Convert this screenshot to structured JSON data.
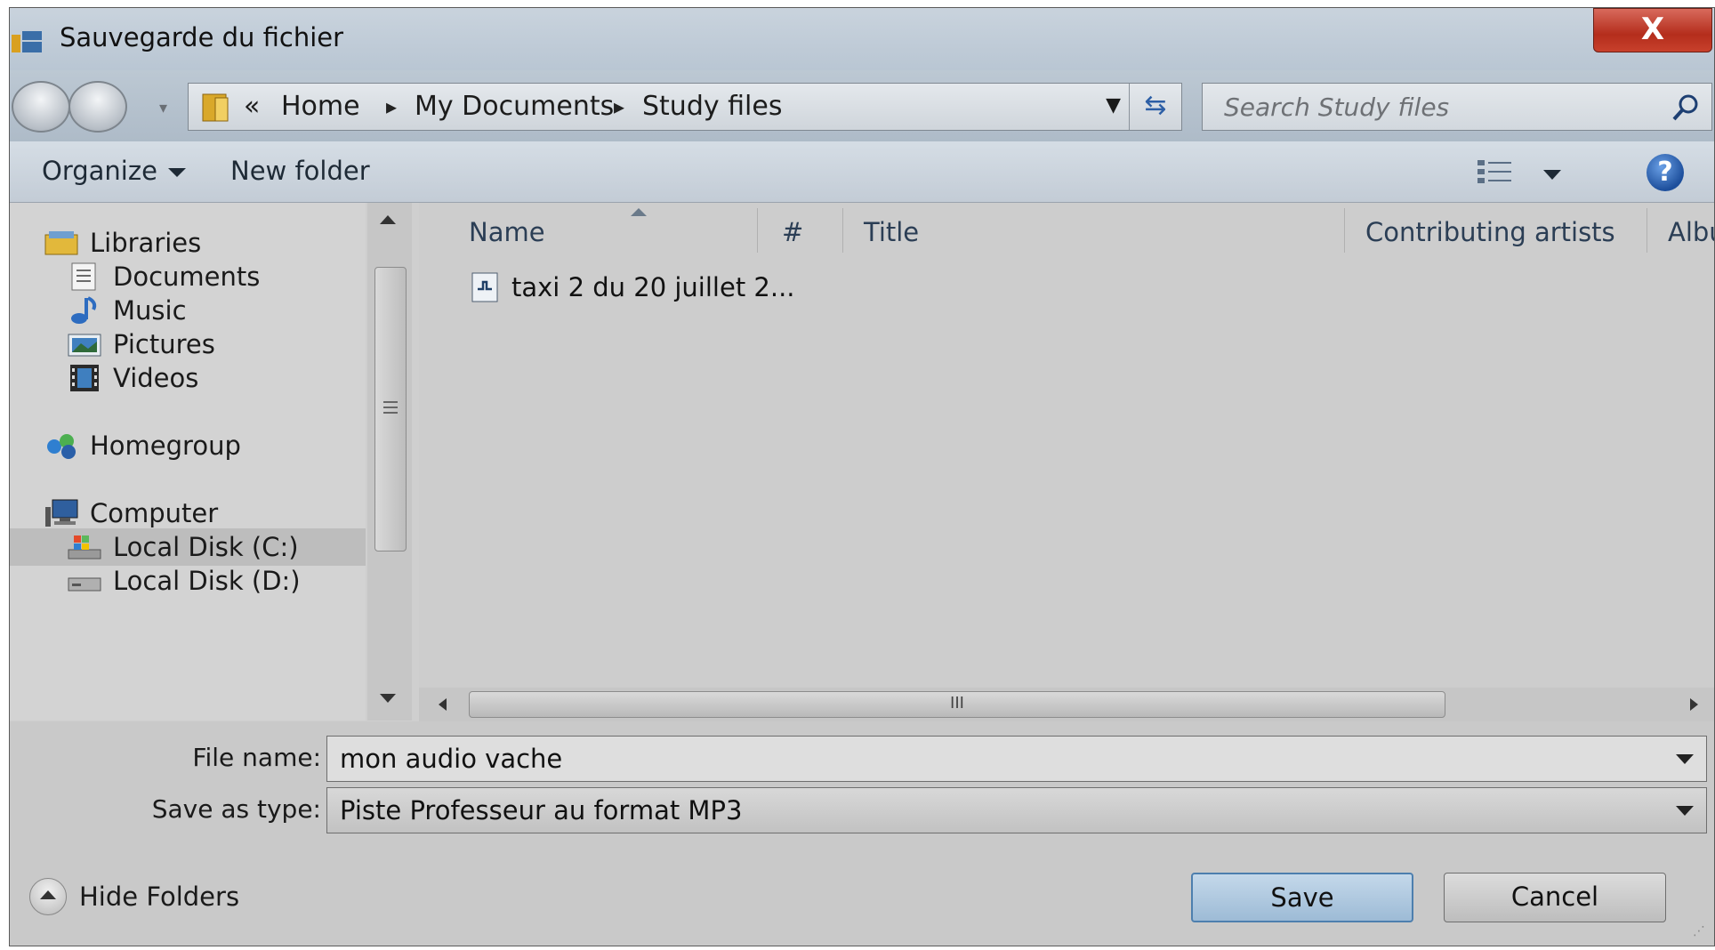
{
  "window": {
    "title": "Sauvegarde du fichier",
    "close_label": "X"
  },
  "address": {
    "prefix": "«",
    "crumbs": [
      "Home",
      "My Documents",
      "Study files"
    ]
  },
  "search": {
    "placeholder": "Search Study files"
  },
  "toolbar": {
    "organize": "Organize",
    "new_folder": "New folder",
    "help": "?"
  },
  "nav_pane": {
    "items": [
      {
        "label": "Libraries",
        "icon": "libraries-icon"
      },
      {
        "label": "Documents",
        "icon": "documents-icon"
      },
      {
        "label": "Music",
        "icon": "music-icon"
      },
      {
        "label": "Pictures",
        "icon": "pictures-icon"
      },
      {
        "label": "Videos",
        "icon": "videos-icon"
      },
      {
        "label": "Homegroup",
        "icon": "homegroup-icon"
      },
      {
        "label": "Computer",
        "icon": "computer-icon"
      },
      {
        "label": "Local Disk (C:)",
        "icon": "disk-c-icon",
        "selected": true
      },
      {
        "label": "Local Disk (D:)",
        "icon": "disk-d-icon"
      }
    ]
  },
  "file_list": {
    "columns": [
      "Name",
      "#",
      "Title",
      "Contributing artists",
      "Albu"
    ],
    "sorted_by": "Name",
    "files": [
      {
        "name": "taxi 2 du 20 juillet 2..."
      }
    ],
    "hscroll_grip": "III"
  },
  "form": {
    "file_name_label": "File name:",
    "file_name_value": "mon audio vache",
    "save_type_label": "Save as type:",
    "save_type_value": "Piste Professeur au format MP3"
  },
  "footer": {
    "hide_folders": "Hide Folders",
    "save": "Save",
    "cancel": "Cancel"
  },
  "colors": {
    "close_button": "#b42d1c",
    "save_button_border": "#4d7fae",
    "background": "#cfcfcf"
  }
}
